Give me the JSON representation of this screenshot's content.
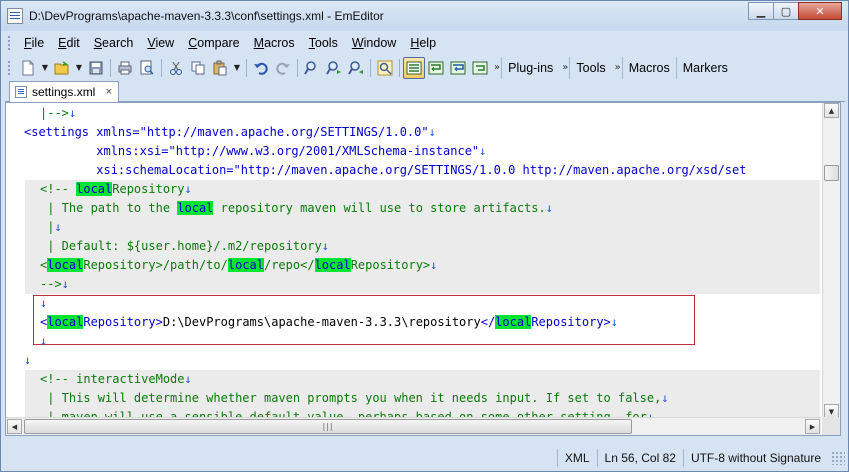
{
  "window": {
    "title": "D:\\DevPrograms\\apache-maven-3.3.3\\conf\\settings.xml - EmEditor",
    "minimize": "▁",
    "maximize": "▢",
    "close": "✕"
  },
  "menu": {
    "items": [
      "File",
      "Edit",
      "Search",
      "View",
      "Compare",
      "Macros",
      "Tools",
      "Window",
      "Help"
    ]
  },
  "toolbar": {
    "groups": [
      "Plug-ins",
      "Tools",
      "Macros",
      "Markers"
    ],
    "overflow": "»"
  },
  "tab": {
    "label": "settings.xml",
    "close": "×"
  },
  "editor": {
    "lines": [
      {
        "indent": 1,
        "grey": false,
        "parts": [
          [
            "com",
            "|-->"
          ],
          [
            "eol",
            "↓"
          ]
        ]
      },
      {
        "indent": 0,
        "grey": false,
        "parts": [
          [
            "tag",
            "<settings "
          ],
          [
            "attr",
            "xmlns="
          ],
          [
            "str",
            "\"http://maven.apache.org/SETTINGS/1.0.0\""
          ],
          [
            "eol",
            "↓"
          ]
        ]
      },
      {
        "indent": 0,
        "grey": false,
        "parts": [
          [
            "text",
            "          "
          ],
          [
            "attr",
            "xmlns:xsi="
          ],
          [
            "str",
            "\"http://www.w3.org/2001/XMLSchema-instance\""
          ],
          [
            "eol",
            "↓"
          ]
        ]
      },
      {
        "indent": 0,
        "grey": false,
        "parts": [
          [
            "text",
            "          "
          ],
          [
            "attr",
            "xsi:schemaLocation="
          ],
          [
            "str",
            "\"http://maven.apache.org/SETTINGS/1.0.0 http://maven.apache.org/xsd/set"
          ]
        ]
      },
      {
        "indent": 1,
        "grey": true,
        "parts": [
          [
            "com",
            "<!-- "
          ],
          [
            "hl",
            "local"
          ],
          [
            "com",
            "Repository"
          ],
          [
            "eol",
            "↓"
          ]
        ]
      },
      {
        "indent": 1,
        "grey": true,
        "parts": [
          [
            "com",
            " | The path to the "
          ],
          [
            "hl",
            "local"
          ],
          [
            "com",
            " repository maven will use to store artifacts."
          ],
          [
            "eol",
            "↓"
          ]
        ]
      },
      {
        "indent": 1,
        "grey": true,
        "parts": [
          [
            "com",
            " |"
          ],
          [
            "eol",
            "↓"
          ]
        ]
      },
      {
        "indent": 1,
        "grey": true,
        "parts": [
          [
            "com",
            " | Default: ${user.home}/.m2/repository"
          ],
          [
            "eol",
            "↓"
          ]
        ]
      },
      {
        "indent": 1,
        "grey": true,
        "parts": [
          [
            "com",
            "<"
          ],
          [
            "hl",
            "local"
          ],
          [
            "com",
            "Repository>/path/to/"
          ],
          [
            "hl",
            "local"
          ],
          [
            "com",
            "/repo</"
          ],
          [
            "hl",
            "local"
          ],
          [
            "com",
            "Repository>"
          ],
          [
            "eol",
            "↓"
          ]
        ]
      },
      {
        "indent": 1,
        "grey": true,
        "parts": [
          [
            "com",
            "-->"
          ],
          [
            "eol",
            "↓"
          ]
        ]
      },
      {
        "indent": 1,
        "grey": false,
        "parts": [
          [
            "eol",
            "↓"
          ]
        ]
      },
      {
        "indent": 1,
        "grey": false,
        "parts": [
          [
            "tag",
            "<"
          ],
          [
            "hl",
            "local"
          ],
          [
            "tag",
            "Repository>"
          ],
          [
            "text",
            "D:\\DevPrograms\\apache-maven-3.3.3\\repository"
          ],
          [
            "tag",
            "</"
          ],
          [
            "hl",
            "local"
          ],
          [
            "tag",
            "Repository>"
          ],
          [
            "eol",
            "↓"
          ]
        ]
      },
      {
        "indent": 1,
        "grey": false,
        "parts": [
          [
            "eol",
            "↓"
          ]
        ]
      },
      {
        "indent": 0,
        "grey": false,
        "parts": [
          [
            "eol",
            "↓"
          ]
        ]
      },
      {
        "indent": 1,
        "grey": true,
        "parts": [
          [
            "com",
            "<!-- interactiveMode"
          ],
          [
            "eol",
            "↓"
          ]
        ]
      },
      {
        "indent": 1,
        "grey": true,
        "parts": [
          [
            "com",
            " | This will determine whether maven prompts you when it needs input. If set to false,"
          ],
          [
            "eol",
            "↓"
          ]
        ]
      },
      {
        "indent": 1,
        "grey": true,
        "parts": [
          [
            "com",
            " | maven will use a sensible default value, perhaps based on some other setting, for"
          ],
          [
            "eol",
            "↓"
          ]
        ]
      }
    ]
  },
  "status": {
    "mode": "XML",
    "position": "Ln 56, Col 82",
    "encoding": "UTF-8 without Signature"
  }
}
